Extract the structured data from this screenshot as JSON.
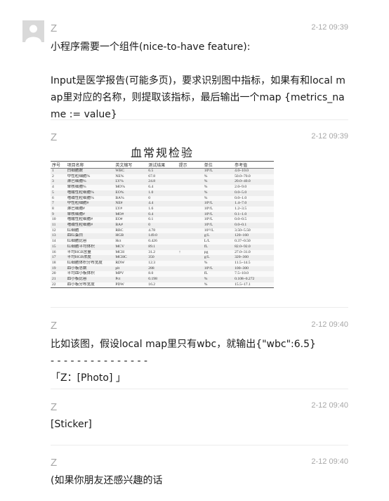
{
  "messages": [
    {
      "sender": "Z",
      "time": "2-12 09:39",
      "text": "小程序需要一个组件(nice-to-have feature):\n\nInput是医学报告(可能多页)，要求识别图中指标，如果有和local map里对应的名称，则提取该指标，最后输出一个map {metrics_name := value}"
    },
    {
      "sender": "Z",
      "time": "2-12 09:39"
    },
    {
      "sender": "Z",
      "time": "2-12 09:40",
      "text": "比如该图，假设local map里只有wbc，就输出{\"wbc\":6.5}\n- - - - - - - - - - - - - - -\n「Z：[Photo] 」"
    },
    {
      "sender": "Z",
      "time": "2-12 09:40",
      "text": "[Sticker]"
    },
    {
      "sender": "Z",
      "time": "2-12 09:40",
      "text": "(如果你朋友还感兴趣的话"
    }
  ],
  "report": {
    "title": "血常规检验",
    "headers": [
      "序号",
      "项目名称",
      "英文缩写",
      "测试结果",
      "提示",
      "单位",
      "参考值"
    ],
    "rows": [
      [
        "1",
        "白细胞数",
        "WBC",
        "6.5",
        "",
        "10⁹/L",
        "4.0~10.0"
      ],
      [
        "2",
        "中性粒细胞%",
        "NE%",
        "67.8",
        "",
        "%",
        "50.0~70.0"
      ],
      [
        "3",
        "淋巴细胞%",
        "LY%",
        "24.8",
        "",
        "%",
        "20.0~40.0"
      ],
      [
        "4",
        "单核细胞%",
        "MO%",
        "6.4",
        "",
        "%",
        "2.0~9.0"
      ],
      [
        "5",
        "嗜酸性粒细胞%",
        "EO%",
        "1.0",
        "",
        "%",
        "0.0~5.0"
      ],
      [
        "6",
        "嗜碱性粒细胞%",
        "BA%",
        "0",
        "",
        "%",
        "0.0~1.0"
      ],
      [
        "7",
        "中性粒细胞#",
        "NE#",
        "4.4",
        "",
        "10⁹/L",
        "1.4~7.0"
      ],
      [
        "8",
        "淋巴细胞#",
        "LY#",
        "1.6",
        "",
        "10⁹/L",
        "1.2~3.5"
      ],
      [
        "9",
        "单核细胞#",
        "MO#",
        "0.4",
        "",
        "10⁹/L",
        "0.1~1.0"
      ],
      [
        "10",
        "嗜酸性粒细胞#",
        "EO#",
        "0.1",
        "",
        "10⁹/L",
        "0.0~0.5"
      ],
      [
        "11",
        "嗜碱性粒细胞#",
        "BA#",
        "0",
        "",
        "10⁹/L",
        "0.0~0.1"
      ],
      [
        "12",
        "红细胞",
        "RBC",
        "4.78",
        "",
        "10¹²/L",
        "3.50~5.50"
      ],
      [
        "13",
        "血红蛋白",
        "HGB",
        "149.0",
        "",
        "g/L",
        "120~160"
      ],
      [
        "14",
        "红细胞比容",
        "Hct",
        "0.426",
        "",
        "L/L",
        "0.37~0.50"
      ],
      [
        "15",
        "红细胞平均体积",
        "MCV",
        "89.1",
        "",
        "fL",
        "82.0~92.0"
      ],
      [
        "16",
        "平均HGB含量",
        "MCH",
        "31.2",
        "↑",
        "pg",
        "27.0~31.0"
      ],
      [
        "17",
        "平均HGB浓度",
        "MCHC",
        "350",
        "",
        "g/L",
        "320~360"
      ],
      [
        "18",
        "红细胞体积分布宽度",
        "RDW",
        "12.3",
        "",
        "%",
        "11.5~14.5"
      ],
      [
        "19",
        "血小板总数",
        "plt",
        "288",
        "",
        "10⁹/L",
        "100~300"
      ],
      [
        "20",
        "平均血小板体积",
        "MPV",
        "8.0",
        "",
        "fL",
        "7.5~10.0"
      ],
      [
        "21",
        "血小板比容",
        "Pct",
        "0.198",
        "",
        "%",
        "0.108~0.272"
      ],
      [
        "22",
        "血小板分布宽度",
        "PDW",
        "16.2",
        "",
        "%",
        "15.5~17.1"
      ]
    ]
  }
}
